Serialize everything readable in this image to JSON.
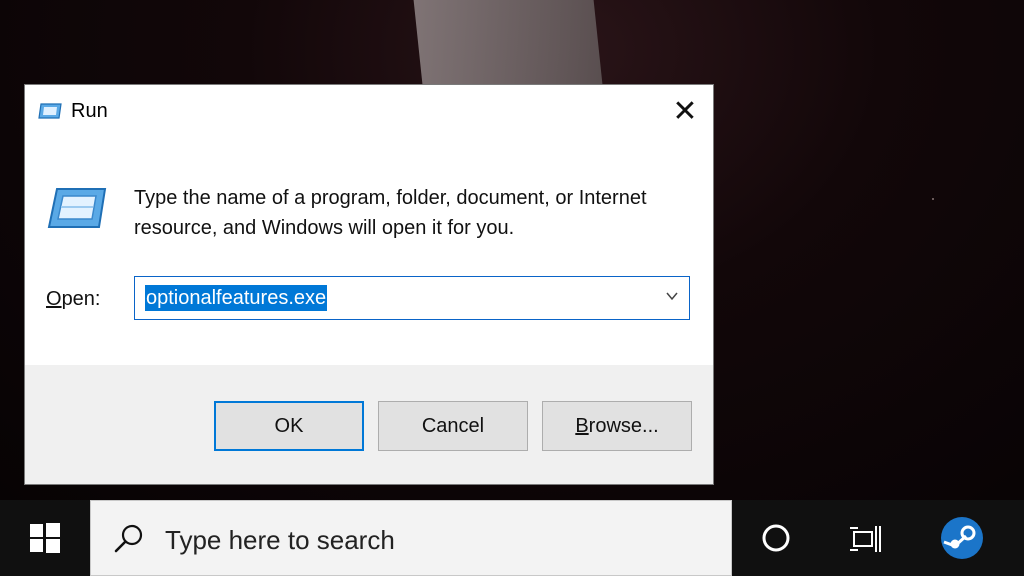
{
  "dialog": {
    "title": "Run",
    "close_symbol": "✕",
    "description": "Type the name of a program, folder, document, or Internet resource, and Windows will open it for you.",
    "open_label_prefix": "",
    "open_label_accel": "O",
    "open_label_rest": "pen:",
    "open_value": "optionalfeatures.exe",
    "buttons": {
      "ok": "OK",
      "cancel": "Cancel",
      "browse_accel": "B",
      "browse_rest": "rowse..."
    }
  },
  "taskbar": {
    "search_placeholder": "Type here to search",
    "icons": [
      "windows-start-icon",
      "search-icon",
      "cortana-icon",
      "task-view-icon",
      "steam-icon"
    ]
  },
  "colors": {
    "accent": "#0078d7",
    "taskbar": "#101010",
    "dialog_footer": "#f0f0f0"
  }
}
